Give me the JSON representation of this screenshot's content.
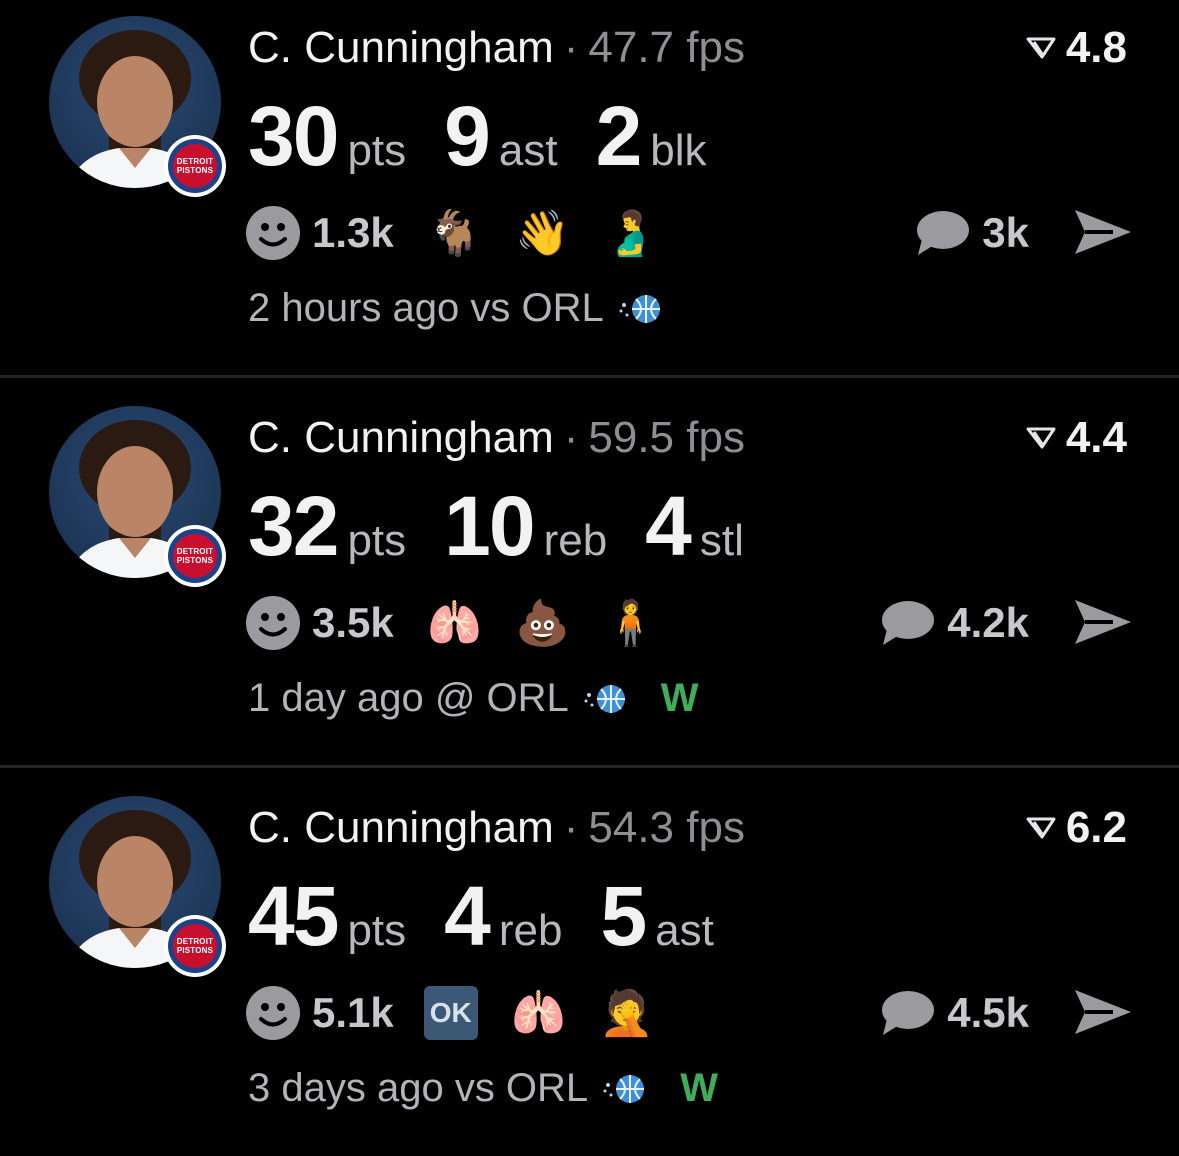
{
  "feed": [
    {
      "player": "C. Cunningham",
      "fps": "47.7 fps",
      "rating": "4.8",
      "stats": [
        {
          "value": "30",
          "unit": "pts"
        },
        {
          "value": "9",
          "unit": "ast"
        },
        {
          "value": "2",
          "unit": "blk"
        }
      ],
      "reaction_count": "1.3k",
      "emojis": [
        "🐐",
        "👋",
        "🫃"
      ],
      "comment_count": "3k",
      "meta": "2 hours ago vs ORL",
      "result": ""
    },
    {
      "player": "C. Cunningham",
      "fps": "59.5 fps",
      "rating": "4.4",
      "stats": [
        {
          "value": "32",
          "unit": "pts"
        },
        {
          "value": "10",
          "unit": "reb"
        },
        {
          "value": "4",
          "unit": "stl"
        }
      ],
      "reaction_count": "3.5k",
      "emojis": [
        "🫁",
        "💩",
        "🧍"
      ],
      "comment_count": "4.2k",
      "meta": "1 day ago @ ORL",
      "result": "W"
    },
    {
      "player": "C. Cunningham",
      "fps": "54.3 fps",
      "rating": "6.2",
      "stats": [
        {
          "value": "45",
          "unit": "pts"
        },
        {
          "value": "4",
          "unit": "reb"
        },
        {
          "value": "5",
          "unit": "ast"
        }
      ],
      "reaction_count": "5.1k",
      "emojis": [
        "OK",
        "🫁",
        "🤦"
      ],
      "comment_count": "4.5k",
      "meta": "3 days ago vs ORL",
      "result": "W"
    }
  ],
  "team_badge": [
    "DETROIT",
    "PISTONS"
  ],
  "icons": {
    "reaction": "smiley-icon",
    "comment": "speech-bubble-icon",
    "share": "paper-plane-icon",
    "rating": "rating-triangle-icon",
    "opponent": "orlando-magic-ball-icon"
  },
  "colors": {
    "background": "#000000",
    "win": "#3fae5a",
    "muted": "#8e8e93"
  }
}
